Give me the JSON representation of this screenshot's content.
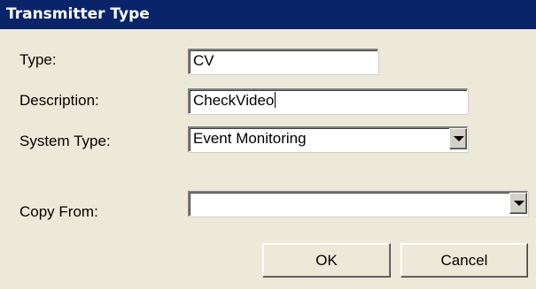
{
  "window": {
    "title": "Transmitter Type"
  },
  "form": {
    "type_label": "Type:",
    "type_value": "CV",
    "description_label": "Description:",
    "description_value": "CheckVideo",
    "system_type_label": "System Type:",
    "system_type_value": "Event Monitoring",
    "copy_from_label": "Copy From:",
    "copy_from_value": ""
  },
  "buttons": {
    "ok_label": "OK",
    "cancel_label": "Cancel"
  },
  "icons": {
    "dropdown": "chevron-down-icon"
  },
  "colors": {
    "titlebar": "#0a246a",
    "background": "#ece9d8"
  }
}
